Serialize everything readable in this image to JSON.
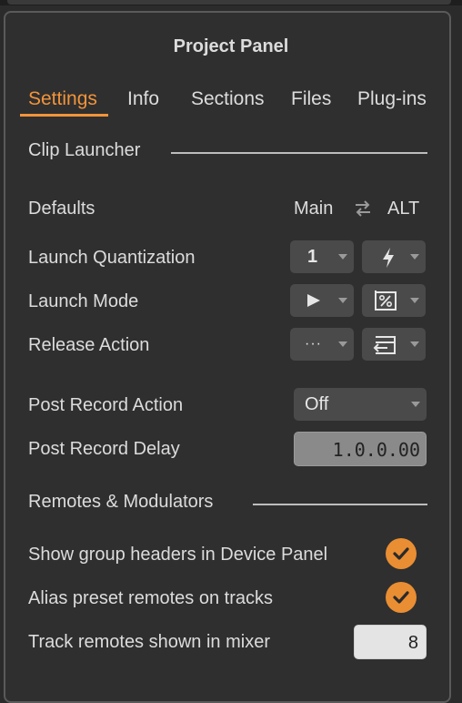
{
  "panel": {
    "title": "Project Panel"
  },
  "tabs": [
    {
      "label": "Settings",
      "active": true
    },
    {
      "label": "Info"
    },
    {
      "label": "Sections"
    },
    {
      "label": "Files"
    },
    {
      "label": "Plug-ins"
    }
  ],
  "clip_launcher": {
    "section_title": "Clip Launcher",
    "defaults_label": "Defaults",
    "main_label": "Main",
    "alt_label": "ALT",
    "swap_icon": "swap-arrows-icon",
    "launch_quantization": {
      "label": "Launch Quantization",
      "main_value": "1",
      "alt_icon": "lightning-icon"
    },
    "launch_mode": {
      "label": "Launch Mode",
      "main_icon": "play-icon",
      "alt_icon": "percent-box-icon"
    },
    "release_action": {
      "label": "Release Action",
      "main_value": "···",
      "alt_icon": "return-icon"
    },
    "post_record_action": {
      "label": "Post Record Action",
      "value": "Off"
    },
    "post_record_delay": {
      "label": "Post Record Delay",
      "value": "1.0.0.00"
    }
  },
  "remotes": {
    "section_title": "Remotes & Modulators",
    "show_group_headers": {
      "label": "Show group headers in Device Panel",
      "checked": true
    },
    "alias_preset_remotes": {
      "label": "Alias preset remotes on tracks",
      "checked": true
    },
    "track_remotes_shown": {
      "label": "Track remotes shown in mixer",
      "value": "8"
    }
  },
  "colors": {
    "accent": "#f2943a",
    "checkbox": "#e98e33",
    "background": "#2f2f2f"
  }
}
